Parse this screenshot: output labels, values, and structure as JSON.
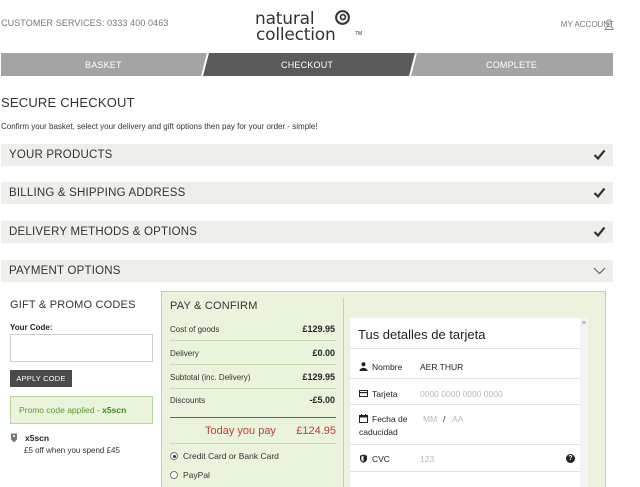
{
  "header": {
    "customer_services": "CUSTOMER SERVICES: 0333 400 0463",
    "logo_line1": "natural",
    "logo_line2": "collection",
    "logo_tm": "TM",
    "account": "MY ACCOUNT"
  },
  "steps": [
    {
      "label": "BASKET",
      "active": false
    },
    {
      "label": "CHECKOUT",
      "active": true
    },
    {
      "label": "COMPLETE",
      "active": false
    }
  ],
  "page": {
    "title": "SECURE CHECKOUT",
    "intro": "Confirm your basket, select your delivery and gift options then pay for your order - simple!"
  },
  "sections": [
    {
      "label": "YOUR PRODUCTS",
      "state": "complete"
    },
    {
      "label": "BILLING & SHIPPING ADDRESS",
      "state": "complete"
    },
    {
      "label": "DELIVERY METHODS & OPTIONS",
      "state": "complete"
    },
    {
      "label": "PAYMENT OPTIONS",
      "state": "expanded"
    }
  ],
  "promo": {
    "title": "GIFT & PROMO CODES",
    "code_label": "Your Code:",
    "code_value": "",
    "apply_label": "APPLY CODE",
    "applied_text": "Promo code applied - ",
    "applied_code": "x5scn",
    "code": "x5scn",
    "desc": "£5 off when you spend £45"
  },
  "pay": {
    "title": "PAY & CONFIRM",
    "rows": [
      {
        "label": "Cost of goods",
        "value": "£129.95"
      },
      {
        "label": "Delivery",
        "value": "£0.00"
      },
      {
        "label": "Subtotal (inc. Delivery)",
        "value": "£129.95"
      },
      {
        "label": "Discounts",
        "value": "-£5.00"
      }
    ],
    "today_label": "Today you pay",
    "today_value": "£124.95",
    "methods": [
      {
        "label": "Credit Card or Bank Card",
        "selected": true
      },
      {
        "label": "PayPal",
        "selected": false
      }
    ]
  },
  "card": {
    "title": "Tus detalles de tarjeta",
    "name_label": "Nombre",
    "name_value": "AER THUR",
    "card_label": "Tarjeta",
    "card_placeholder": "0000 0000 0000 0000",
    "expiry_label_1": "Fecha de",
    "expiry_label_2": "caducidad",
    "expiry_mm": "MM",
    "expiry_sep": "/",
    "expiry_aa": "AA",
    "cvc_label": "CVC",
    "cvc_placeholder": "123",
    "help": "?"
  },
  "colors": {
    "step_inactive": "#a4a4a4",
    "step_active": "#5a5a5a",
    "section_bar": "#eeeeea",
    "pay_panel": "#eaf4dd",
    "today_red": "#c43a3a",
    "promo_green": "#3a8a10"
  }
}
